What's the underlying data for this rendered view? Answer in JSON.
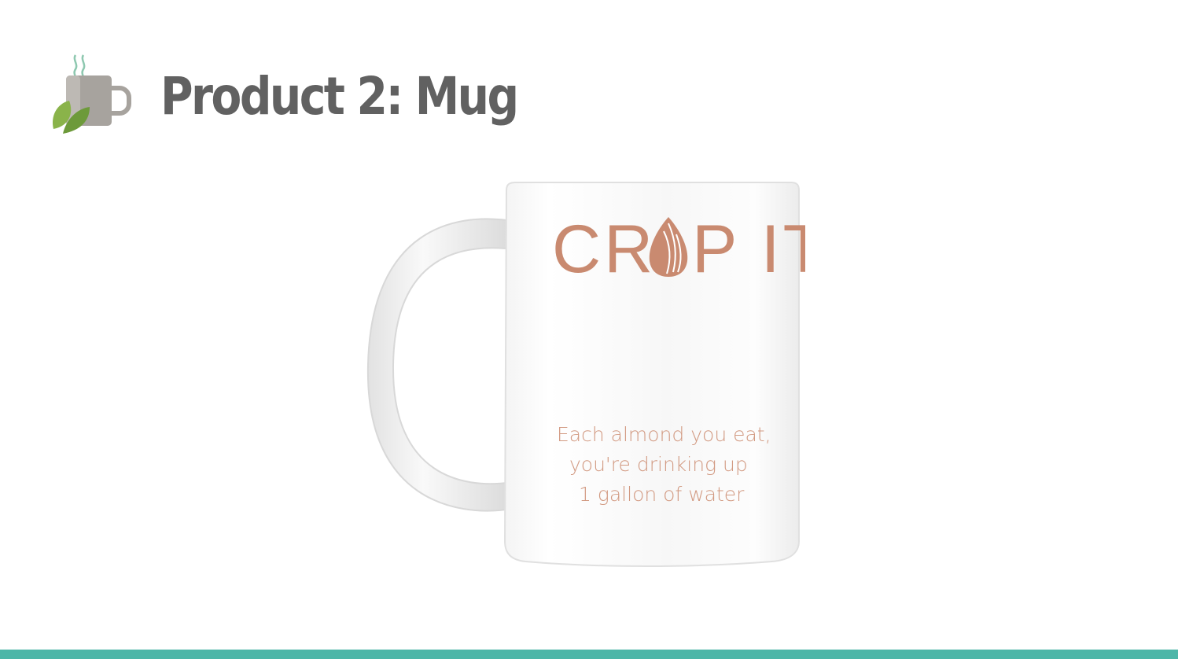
{
  "slide": {
    "title": "Product 2: Mug",
    "logo_icon": "mug-with-leaves-icon"
  },
  "mug": {
    "brand_left": "CR",
    "brand_mark": "almond-icon",
    "brand_right": "P IT",
    "caption_line_1": "Each almond you eat,",
    "caption_line_2": "you're drinking up",
    "caption_line_3": "1 gallon of water"
  },
  "colors": {
    "title": "#616161",
    "accent_bar": "#4db6a8",
    "mug_print": "#c98a70",
    "leaf_green": "#8ab34a",
    "steam": "#8ec8b0"
  }
}
